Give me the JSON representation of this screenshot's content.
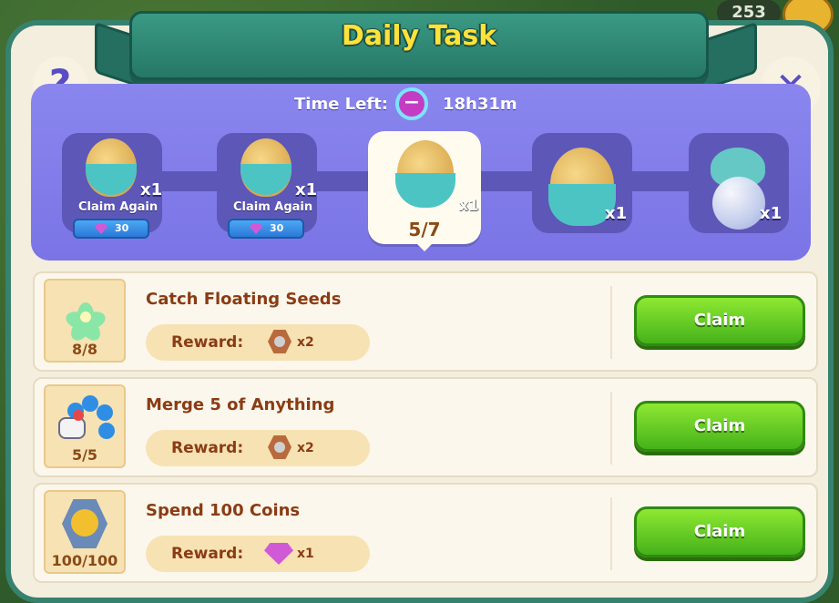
{
  "header": {
    "title": "Daily Task"
  },
  "background": {
    "counter": "253"
  },
  "buttons": {
    "help": "?",
    "close": "✕"
  },
  "timer": {
    "label": "Time Left:",
    "value": "18h31m"
  },
  "milestones": [
    {
      "icon": "egg-icon",
      "quantity": "x1",
      "status": "Claim Again",
      "cost": "30"
    },
    {
      "icon": "egg-icon",
      "quantity": "x1",
      "status": "Claim Again",
      "cost": "30"
    },
    {
      "icon": "egg-icon",
      "quantity": "x1",
      "progress": "5/7"
    },
    {
      "icon": "egg-icon",
      "quantity": "x1"
    },
    {
      "icon": "slime-bubble-icon",
      "quantity": "x1"
    }
  ],
  "tasks": [
    {
      "title": "Catch Floating Seeds",
      "progress": "8/8",
      "reward_label": "Reward:",
      "reward_icon": "seed-pack-icon",
      "reward_qty": "x2",
      "button": "Claim"
    },
    {
      "title": "Merge 5 of Anything",
      "progress": "5/5",
      "reward_label": "Reward:",
      "reward_icon": "seed-pack-icon",
      "reward_qty": "x2",
      "button": "Claim"
    },
    {
      "title": "Spend 100 Coins",
      "progress": "100/100",
      "reward_label": "Reward:",
      "reward_icon": "gem-icon",
      "reward_qty": "x1",
      "button": "Claim"
    }
  ],
  "colors": {
    "accent": "#37826f",
    "title": "#ffe23a",
    "track": "#7a74e6",
    "claim": "#45b21a",
    "text": "#8a3c14"
  }
}
